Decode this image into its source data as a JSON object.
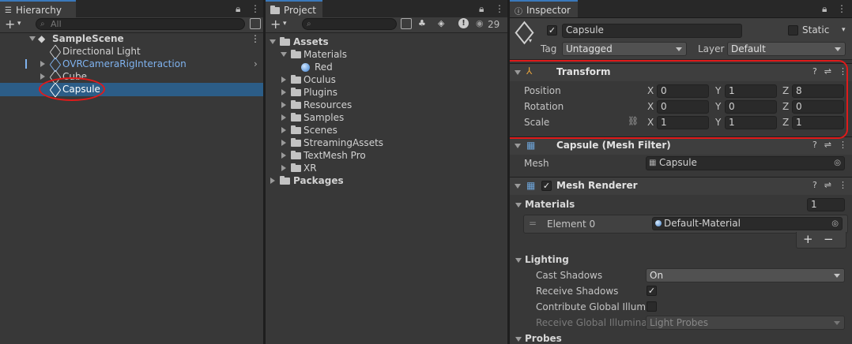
{
  "hierarchy": {
    "tab_label": "Hierarchy",
    "search_placeholder": "All",
    "scene_name": "SampleScene",
    "items": [
      {
        "label": "Directional Light"
      },
      {
        "label": "OVRCameraRigInteraction"
      },
      {
        "label": "Cube"
      },
      {
        "label": "Capsule"
      }
    ]
  },
  "project": {
    "tab_label": "Project",
    "hidden_count": "29",
    "assets_label": "Assets",
    "materials_folder": "Materials",
    "material_item": "Red",
    "folders": [
      "Oculus",
      "Plugins",
      "Resources",
      "Samples",
      "Scenes",
      "StreamingAssets",
      "TextMesh Pro",
      "XR"
    ],
    "packages_label": "Packages"
  },
  "inspector": {
    "tab_label": "Inspector",
    "object_name": "Capsule",
    "static_label": "Static",
    "tag_label": "Tag",
    "tag_value": "Untagged",
    "layer_label": "Layer",
    "layer_value": "Default",
    "transform": {
      "title": "Transform",
      "position_label": "Position",
      "rotation_label": "Rotation",
      "scale_label": "Scale",
      "position": {
        "x": "0",
        "y": "1",
        "z": "8"
      },
      "rotation": {
        "x": "0",
        "y": "0",
        "z": "0"
      },
      "scale": {
        "x": "1",
        "y": "1",
        "z": "1"
      }
    },
    "mesh_filter": {
      "title": "Capsule (Mesh Filter)",
      "mesh_label": "Mesh",
      "mesh_value": "Capsule"
    },
    "mesh_renderer": {
      "title": "Mesh Renderer",
      "materials_label": "Materials",
      "materials_count": "1",
      "element_label": "Element 0",
      "element_value": "Default-Material",
      "lighting_label": "Lighting",
      "cast_shadows_label": "Cast Shadows",
      "cast_shadows_value": "On",
      "receive_shadows_label": "Receive Shadows",
      "contribute_gi_label": "Contribute Global Illumin",
      "receive_gi_label": "Receive Global Illuminati",
      "receive_gi_value": "Light Probes",
      "probes_label": "Probes"
    }
  },
  "colors": {
    "selection": "#2c5d87",
    "prefab_blue": "#7fb2ee",
    "annotation": "#e01a1a"
  }
}
